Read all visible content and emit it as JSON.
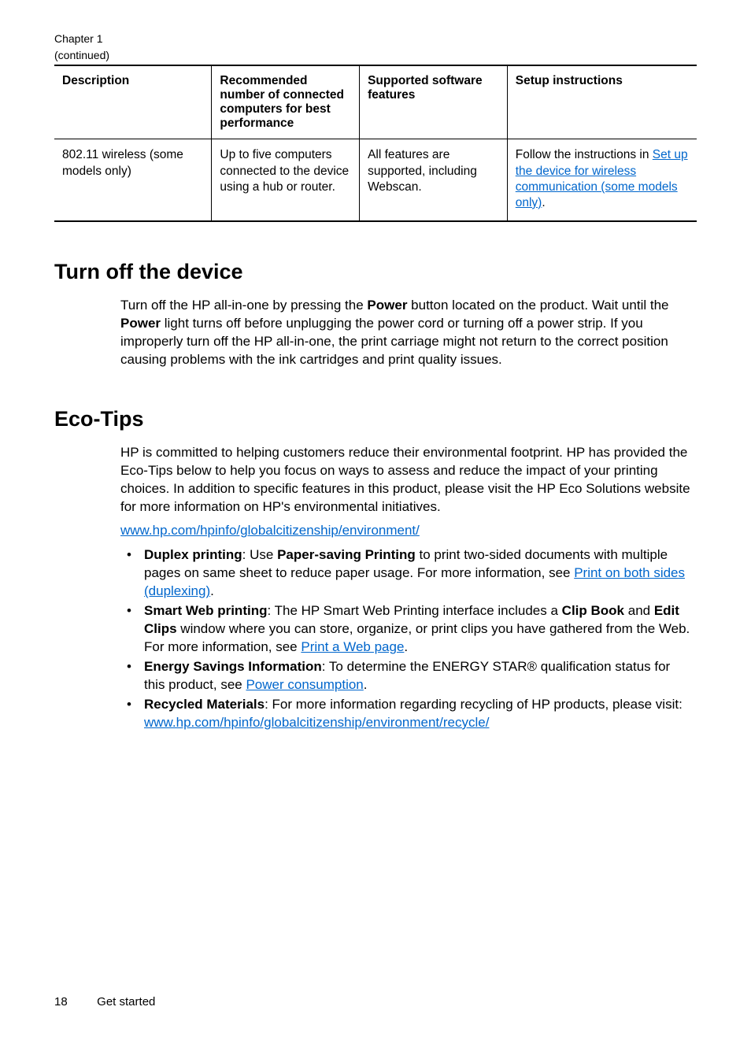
{
  "header": {
    "chapter": "Chapter 1",
    "continued": "(continued)"
  },
  "table": {
    "headers": {
      "col1": "Description",
      "col2": "Recommended number of connected computers for best performance",
      "col3": "Supported software features",
      "col4": "Setup instructions"
    },
    "row": {
      "description": "802.11 wireless (some models only)",
      "recommended": "Up to five computers connected to the device using a hub or router.",
      "features": "All features are supported, including Webscan.",
      "setup_pre": "Follow the instructions in ",
      "setup_link": "Set up the device for wireless communication (some models only)",
      "setup_post": "."
    }
  },
  "section1": {
    "heading": "Turn off the device",
    "p1_pre": "Turn off the HP all-in-one by pressing the ",
    "p1_b1": "Power",
    "p1_mid": " button located on the product. Wait until the ",
    "p1_b2": "Power",
    "p1_post": " light turns off before unplugging the power cord or turning off a power strip. If you improperly turn off the HP all-in-one, the print carriage might not return to the correct position causing problems with the ink cartridges and print quality issues."
  },
  "section2": {
    "heading": "Eco-Tips",
    "intro": "HP is committed to helping customers reduce their environmental footprint. HP has provided the Eco-Tips below to help you focus on ways to assess and reduce the impact of your printing choices. In addition to specific features in this product, please visit the HP Eco Solutions website for more information on HP's environmental initiatives.",
    "env_link": "www.hp.com/hpinfo/globalcitizenship/environment/",
    "tips": {
      "t1_b1": "Duplex printing",
      "t1_txt1": ": Use ",
      "t1_b2": "Paper-saving Printing",
      "t1_txt2": " to print two-sided documents with multiple pages on same sheet to reduce paper usage. For more information, see ",
      "t1_link": "Print on both sides (duplexing)",
      "t1_post": ".",
      "t2_b1": "Smart Web printing",
      "t2_txt1": ": The HP Smart Web Printing interface includes a ",
      "t2_b2": "Clip Book",
      "t2_txt2": " and ",
      "t2_b3": "Edit Clips",
      "t2_txt3": " window where you can store, organize, or print clips you have gathered from the Web. For more information, see ",
      "t2_link": "Print a Web page",
      "t2_post": ".",
      "t3_b1": "Energy Savings Information",
      "t3_txt1": ": To determine the ENERGY STAR® qualification status for this product, see ",
      "t3_link": "Power consumption",
      "t3_post": ".",
      "t4_b1": "Recycled Materials",
      "t4_txt1": ": For more information regarding recycling of HP products, please visit:",
      "t4_link": "www.hp.com/hpinfo/globalcitizenship/environment/recycle/"
    }
  },
  "footer": {
    "page": "18",
    "section": "Get started"
  }
}
